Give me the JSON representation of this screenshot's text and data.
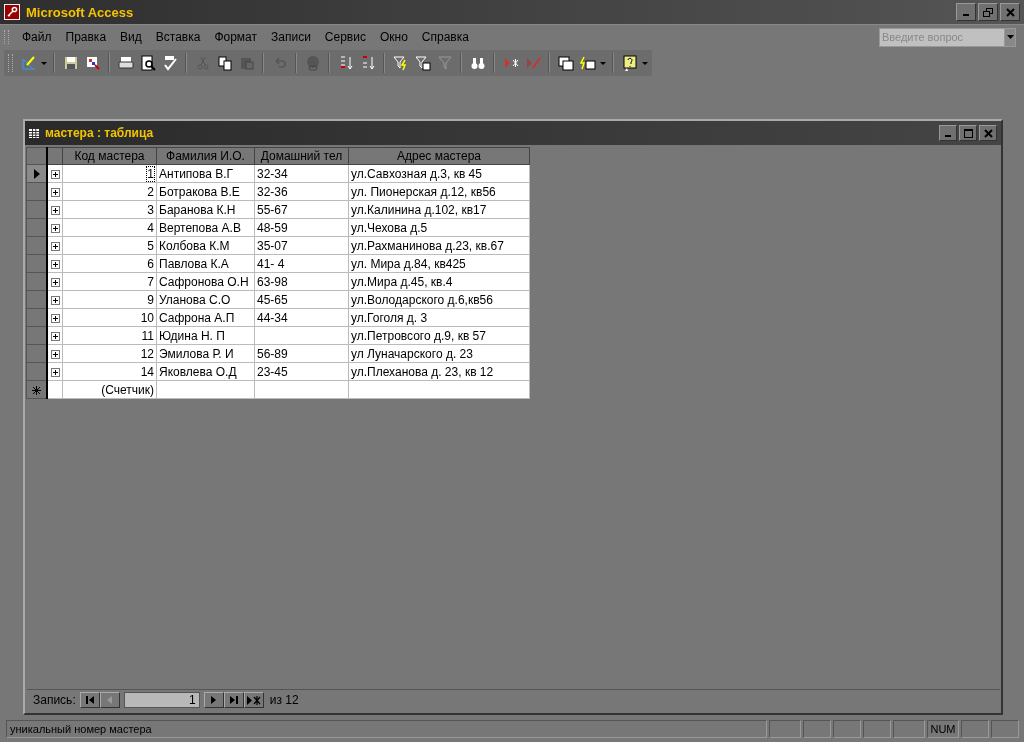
{
  "window": {
    "title": "Microsoft Access"
  },
  "menu": {
    "items": [
      "Файл",
      "Правка",
      "Вид",
      "Вставка",
      "Формат",
      "Записи",
      "Сервис",
      "Окно",
      "Справка"
    ]
  },
  "help_box": {
    "placeholder": "Введите вопрос"
  },
  "child_window": {
    "title": "мастера : таблица"
  },
  "table": {
    "columns": [
      "Код мастера",
      "Фамилия И.О.",
      "Домашний тел",
      "Адрес мастера"
    ],
    "rows": [
      {
        "current": true,
        "expanded": false,
        "cells": [
          "1",
          "Антипова  В.Г",
          "32-34",
          "ул.Савхозная д.3, кв 45"
        ]
      },
      {
        "current": false,
        "expanded": false,
        "cells": [
          "2",
          "Ботракова В.Е",
          "32-36",
          "ул. Пионерская д.12, кв56"
        ]
      },
      {
        "current": false,
        "expanded": false,
        "cells": [
          "3",
          " Баранова К.Н",
          "55-67",
          "ул.Калинина д.102, кв17"
        ]
      },
      {
        "current": false,
        "expanded": false,
        "cells": [
          "4",
          "Вертепова А.В",
          "48-59",
          "ул.Чехова д.5"
        ]
      },
      {
        "current": false,
        "expanded": false,
        "cells": [
          "5",
          "Колбова К.М",
          "35-07",
          "ул.Рахманинова д.23, кв.67"
        ]
      },
      {
        "current": false,
        "expanded": false,
        "cells": [
          "6",
          "Павлова К.А",
          "41- 4",
          "ул. Мира д.84, кв425"
        ]
      },
      {
        "current": false,
        "expanded": false,
        "cells": [
          "7",
          "Сафронова О.Н",
          "63-98",
          "ул.Мира д.45, кв.4"
        ]
      },
      {
        "current": false,
        "expanded": false,
        "cells": [
          "9",
          "Уланова С.О",
          "45-65",
          "ул.Володарского д.6,кв56"
        ]
      },
      {
        "current": false,
        "expanded": false,
        "cells": [
          "10",
          "Сафрона А.П",
          "44-34",
          "ул.Гоголя д. 3"
        ]
      },
      {
        "current": false,
        "expanded": false,
        "cells": [
          "11",
          "Юдина Н. П",
          "",
          "ул.Петровсого д.9, кв 57"
        ]
      },
      {
        "current": false,
        "expanded": false,
        "cells": [
          "12",
          "Эмилова Р. И",
          "56-89",
          "ул Луначарского д. 23"
        ]
      },
      {
        "current": false,
        "expanded": false,
        "cells": [
          "14",
          "Яковлева О.Д",
          "23-45",
          "ул.Плеханова д. 23, кв 12"
        ]
      }
    ],
    "new_row": {
      "code": "(Счетчик)"
    }
  },
  "record_nav": {
    "label": "Запись:",
    "value": "1",
    "total": "из  12"
  },
  "status_bar": {
    "text": "уникальный номер мастера",
    "num_indicator": "NUM"
  }
}
